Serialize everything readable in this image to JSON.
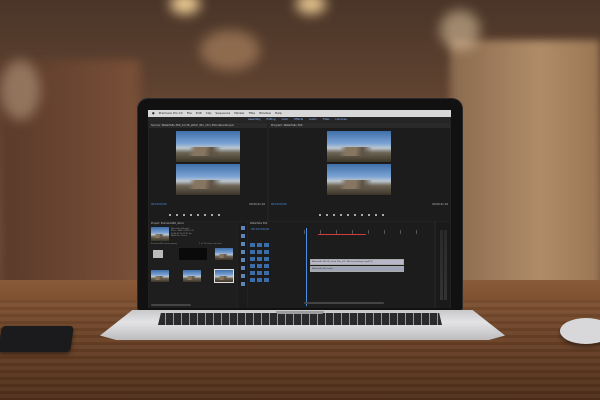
{
  "scene": {
    "description_colors": {
      "table": "#6e4428",
      "background": "#6b4a35",
      "laptop_lid": "#111111",
      "laptop_base": "#d8d8da"
    }
  },
  "app": {
    "name": "Premiere Pro CC",
    "menu": [
      "File",
      "Edit",
      "Clip",
      "Sequence",
      "Marker",
      "Title",
      "Window",
      "Help"
    ],
    "workspaces": [
      "Assembly",
      "Editing",
      "Color",
      "Effects",
      "Audio",
      "Titles",
      "Libraries"
    ],
    "source_panel_title": "Source: Waterfalls 360_vid 2K_stitch (Pro_r01) 360 stereoScopic",
    "program_panel_title": "Program: Waterfalls 360",
    "source_timecode": "00;00;00;00",
    "source_duration": "00;00;41;16",
    "program_timecode": "00;00;00;00",
    "program_duration": "00;00;41;16",
    "project_panel_title": "Project: Premiere360_demo",
    "project_meta": [
      "Waterfalls 360.mp4",
      "Movie, 3840 x 2160 (1.0)",
      "00;00;41;16, 29.97 fps",
      "48000 Hz - Stereo"
    ],
    "bin_path": "Premiere360_demo.prproj",
    "item_count": "1 of 12 items selected",
    "timeline_title": "Waterfalls 360",
    "timeline_timecode": "00;00;00;00",
    "clip_label": "Waterfalls 360 2K_stitch (Pro_r01) 360 stereoScopic.mp4 [V]",
    "audio_clip_label": "Waterfalls 360 audio"
  }
}
